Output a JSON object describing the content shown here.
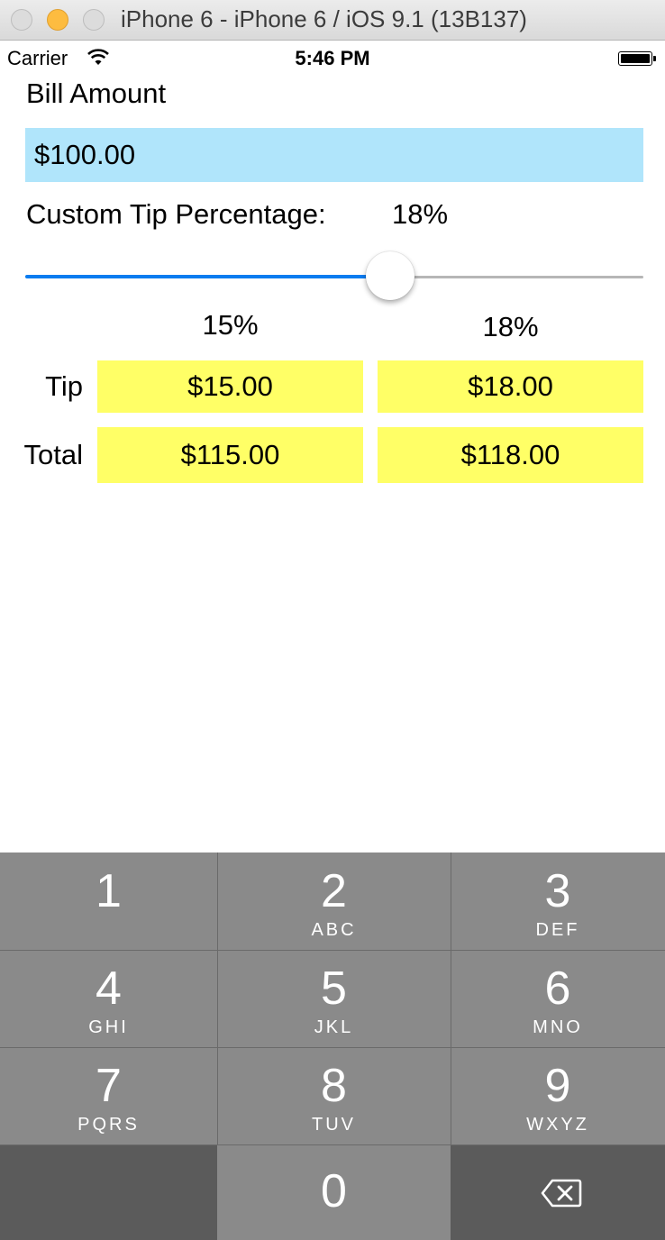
{
  "window": {
    "title": "iPhone 6 - iPhone 6 / iOS 9.1 (13B137)"
  },
  "status_bar": {
    "carrier": "Carrier",
    "time": "5:46 PM"
  },
  "bill": {
    "label": "Bill Amount",
    "value": "$100.00"
  },
  "custom_tip": {
    "label": "Custom Tip Percentage:",
    "value_text": "18%",
    "slider_fraction": 0.59
  },
  "results": {
    "columns": [
      "15%",
      "18%"
    ],
    "tip": {
      "label": "Tip",
      "values": [
        "$15.00",
        "$18.00"
      ]
    },
    "total": {
      "label": "Total",
      "values": [
        "$115.00",
        "$118.00"
      ]
    }
  },
  "colors": {
    "input_bg": "#b0e5fb",
    "result_bg": "#ffff66",
    "slider_tint": "#0a7cf0",
    "keypad_bg": "#8a8a8a"
  },
  "keypad": {
    "keys": [
      {
        "num": "1",
        "letters": ""
      },
      {
        "num": "2",
        "letters": "ABC"
      },
      {
        "num": "3",
        "letters": "DEF"
      },
      {
        "num": "4",
        "letters": "GHI"
      },
      {
        "num": "5",
        "letters": "JKL"
      },
      {
        "num": "6",
        "letters": "MNO"
      },
      {
        "num": "7",
        "letters": "PQRS"
      },
      {
        "num": "8",
        "letters": "TUV"
      },
      {
        "num": "9",
        "letters": "WXYZ"
      },
      {
        "num": "0",
        "letters": ""
      }
    ],
    "delete_icon": "backspace-icon"
  }
}
